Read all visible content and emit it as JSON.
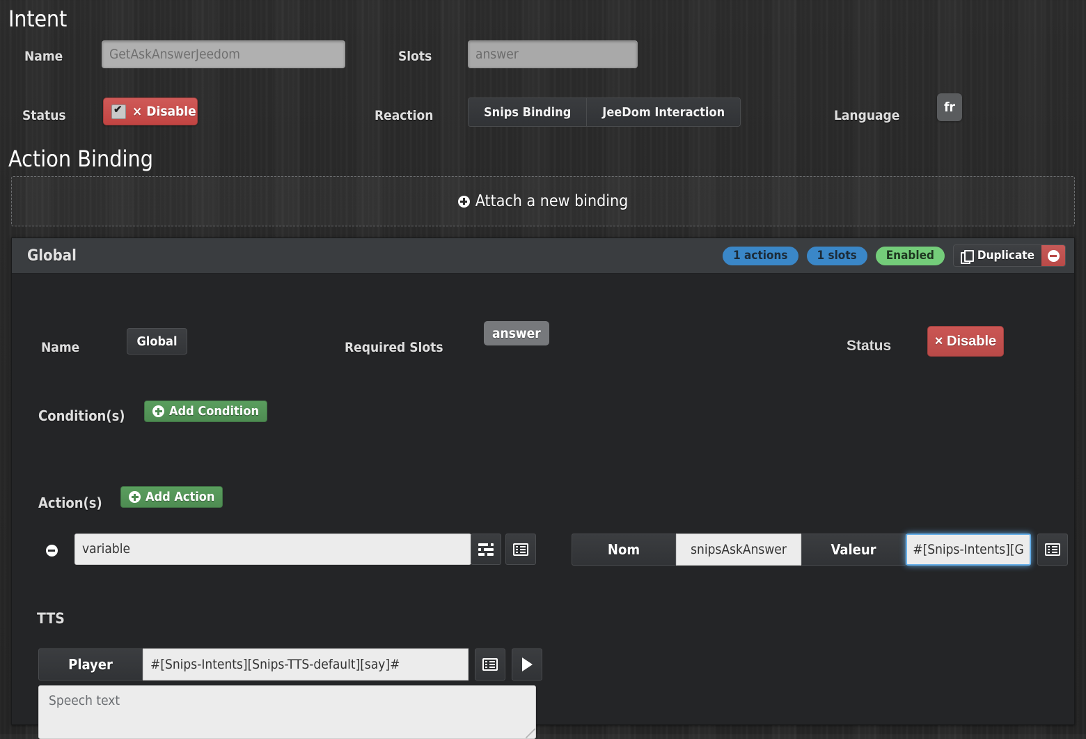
{
  "intent": {
    "title": "Intent",
    "name_label": "Name",
    "name_value": "GetAskAnswerJeedom",
    "slots_label": "Slots",
    "slots_value": "answer",
    "status_label": "Status",
    "status_button": "× Disable",
    "reaction_label": "Reaction",
    "reaction_options": [
      "Snips Binding",
      "JeeDom Interaction"
    ],
    "language_label": "Language",
    "language_value": "fr"
  },
  "action_binding": {
    "title": "Action Binding",
    "attach_label": "Attach a new binding"
  },
  "global_panel": {
    "title": "Global",
    "badges": {
      "actions": "1 actions",
      "slots": "1 slots",
      "enabled": "Enabled"
    },
    "duplicate_label": "Duplicate",
    "name_label": "Name",
    "name_value": "Global",
    "required_slots_label": "Required Slots",
    "required_slots_value": "answer",
    "status_label": "Status",
    "status_button": "× Disable",
    "conditions_label": "Condition(s)",
    "add_condition_label": "Add Condition",
    "actions_label": "Action(s)",
    "add_action_label": "Add Action",
    "action_row": {
      "command_value": "variable",
      "nom_label": "Nom",
      "nom_value": "snipsAskAnswer",
      "valeur_label": "Valeur",
      "valeur_value": "#[Snips-Intents][G"
    },
    "tts": {
      "label": "TTS",
      "player_label": "Player",
      "player_value": "#[Snips-Intents][Snips-TTS-default][say]#",
      "speech_placeholder": "Speech text"
    }
  },
  "colors": {
    "danger": "#b94a48",
    "success": "#4e8c52",
    "info": "#3a87c8",
    "enabled": "#74cd7a",
    "focus": "#66afe9",
    "panel": "#242527",
    "panel_header": "#3a3d40"
  }
}
